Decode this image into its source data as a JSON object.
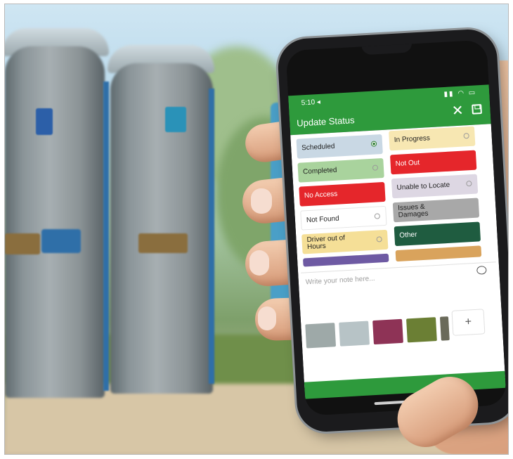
{
  "status_bar": {
    "time": "5:10 ◂",
    "icons": "▮▮ ◠ ▭"
  },
  "app_bar": {
    "title": "Update Status",
    "close_icon": "✕",
    "save_icon": "save"
  },
  "status_options": [
    {
      "label": "Scheduled",
      "color": "#c9d8e4",
      "text_color": "#1f1f1f",
      "selected": true
    },
    {
      "label": "In Progress",
      "color": "#f7e7b2",
      "text_color": "#1f1f1f",
      "selected": false
    },
    {
      "label": "Completed",
      "color": "#a9d39d",
      "text_color": "#1f1f1f",
      "selected": false
    },
    {
      "label": "Not Out",
      "color": "#e5262b",
      "text_color": "#ffffff",
      "selected": false
    },
    {
      "label": "No Access",
      "color": "#e5262b",
      "text_color": "#ffffff",
      "selected": false
    },
    {
      "label": "Unable to Locate",
      "color": "#ddd7e3",
      "text_color": "#1f1f1f",
      "selected": false
    },
    {
      "label": "Not Found",
      "color": "#ffffff",
      "text_color": "#1f1f1f",
      "selected": false
    },
    {
      "label": "Issues & Damages",
      "color": "#a8a8a8",
      "text_color": "#1f1f1f",
      "selected": false
    },
    {
      "label": "Driver out of Hours",
      "color": "#f5df97",
      "text_color": "#1f1f1f",
      "selected": false
    },
    {
      "label": "Other",
      "color": "#1f5c40",
      "text_color": "#ffffff",
      "selected": false
    },
    {
      "label": "",
      "color": "#6e5aa3",
      "text_color": "#ffffff",
      "selected": false
    },
    {
      "label": "",
      "color": "#d9a35c",
      "text_color": "#1f1f1f",
      "selected": false
    }
  ],
  "note": {
    "placeholder": "Write your note here..."
  },
  "photos": {
    "add_label": "+",
    "thumbnails": [
      {
        "name": "photo-1",
        "color": "#9ea9a8"
      },
      {
        "name": "photo-2",
        "color": "#b7c3c6"
      },
      {
        "name": "photo-3",
        "color": "#8e3356"
      },
      {
        "name": "photo-4",
        "color": "#6b7f34"
      },
      {
        "name": "photo-5",
        "color": "#6a6a5a"
      }
    ]
  },
  "colors": {
    "brand_green": "#2e9a3c"
  }
}
